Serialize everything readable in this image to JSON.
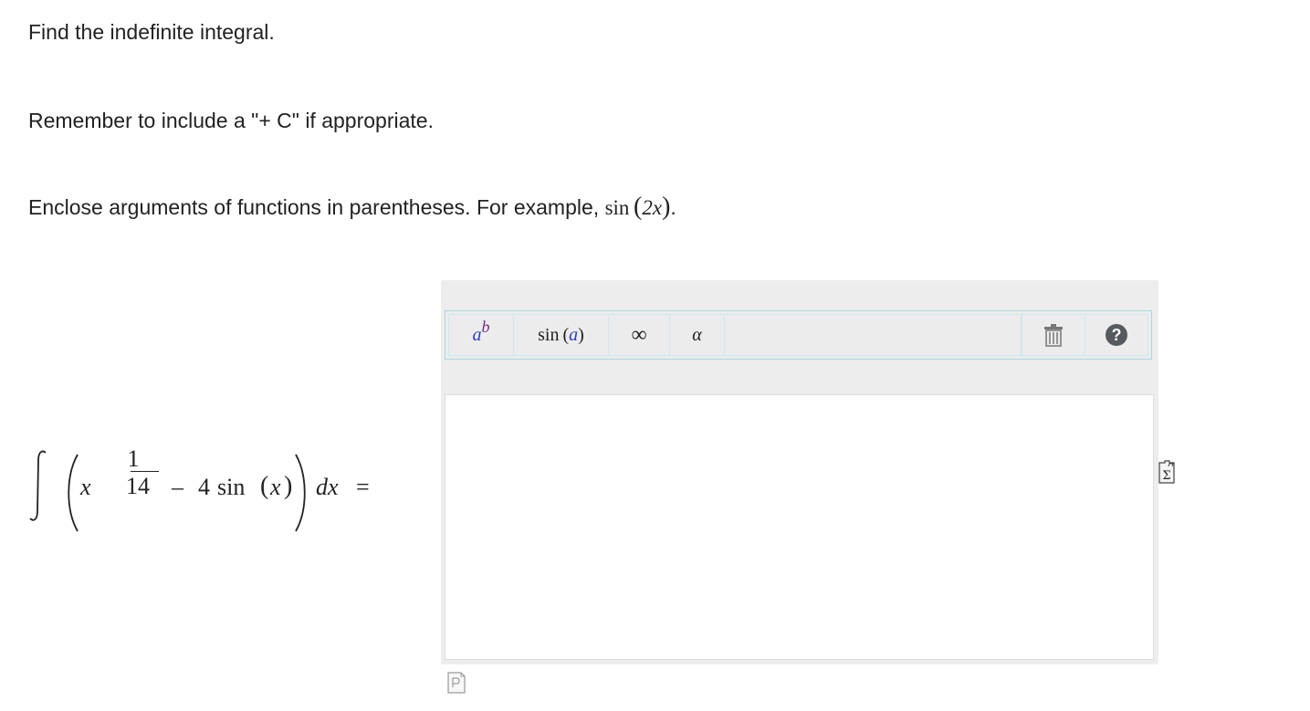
{
  "instructions": {
    "line1": "Find the indefinite integral.",
    "line2": "Remember to include a \"+ C\" if appropriate.",
    "line3_prefix": "Enclose arguments of functions in parentheses. For example, ",
    "example_func": "sin",
    "example_open": "(",
    "example_arg": "2x",
    "example_close": ")",
    "line3_suffix": "."
  },
  "problem": {
    "base": "x",
    "exp_numerator": "1",
    "exp_denominator": "14",
    "minus": "–",
    "coefficient": "4",
    "func": "sin",
    "arg_open": "(",
    "arg": "x",
    "arg_close": ")",
    "differential": "dx",
    "equals": "="
  },
  "toolbar": {
    "superscript_base": "a",
    "superscript_exp": "b",
    "sin_func": "sin",
    "sin_open": "(",
    "sin_arg": "a",
    "sin_close": ")",
    "infinity": "∞",
    "alpha": "α",
    "help": "?",
    "clear_icon": "trash-icon",
    "help_icon": "help-icon"
  },
  "answer": {
    "value": ""
  },
  "icons": {
    "side": "equation-editor-icon",
    "bottom": "preview-icon"
  }
}
